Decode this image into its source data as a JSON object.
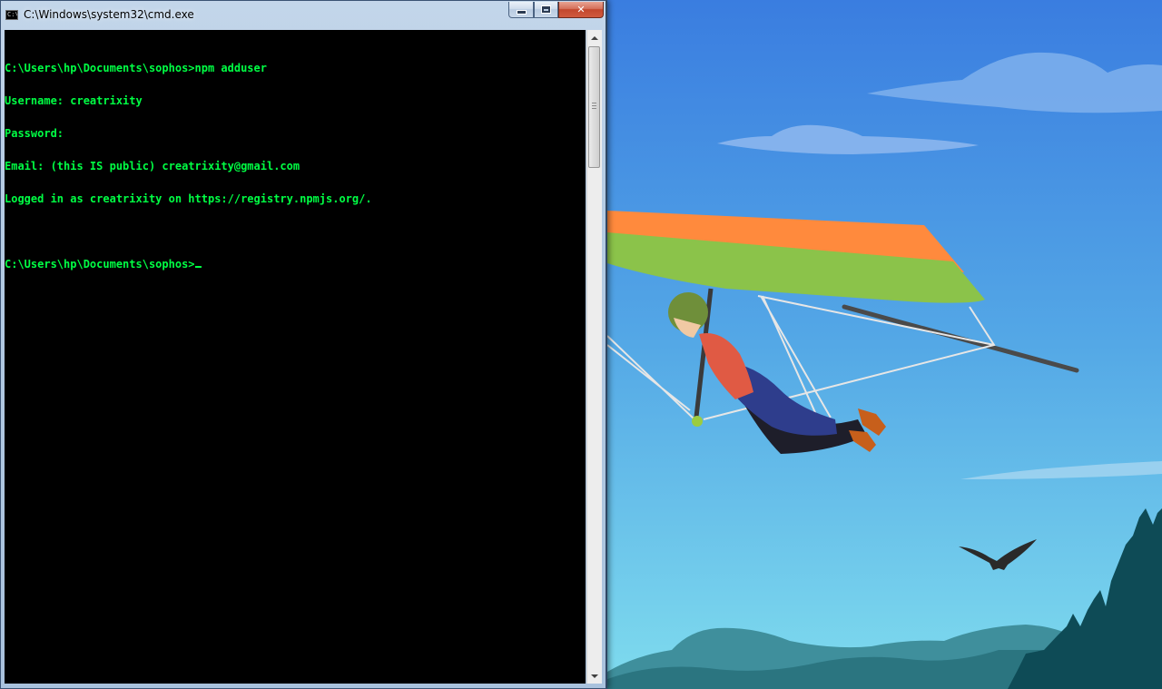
{
  "window": {
    "title": "C:\\Windows\\system32\\cmd.exe",
    "icon": "cmd-icon",
    "icon_text": "C:\\",
    "buttons": {
      "minimize_icon": "minimize-icon",
      "maximize_icon": "maximize-icon",
      "close_icon": "close-icon",
      "close_glyph": "✕"
    }
  },
  "console": {
    "text_color": "#00ff44",
    "background_color": "#000000",
    "lines": [
      "C:\\Users\\hp\\Documents\\sophos>npm adduser",
      "Username: creatrixity",
      "Password:",
      "Email: (this IS public) creatrixity@gmail.com",
      "Logged in as creatrixity on https://registry.npmjs.org/.",
      "",
      "C:\\Users\\hp\\Documents\\sophos>"
    ]
  },
  "scrollbar": {
    "position_fraction": 0.0
  },
  "wallpaper": {
    "sky_top_color": "#3b7fe0",
    "sky_bottom_color": "#7ad8ee",
    "wing_orange": "#ff8a3d",
    "wing_green": "#8bc34a",
    "mountain_color": "#2f7a86",
    "tree_color": "#0f4a55"
  }
}
